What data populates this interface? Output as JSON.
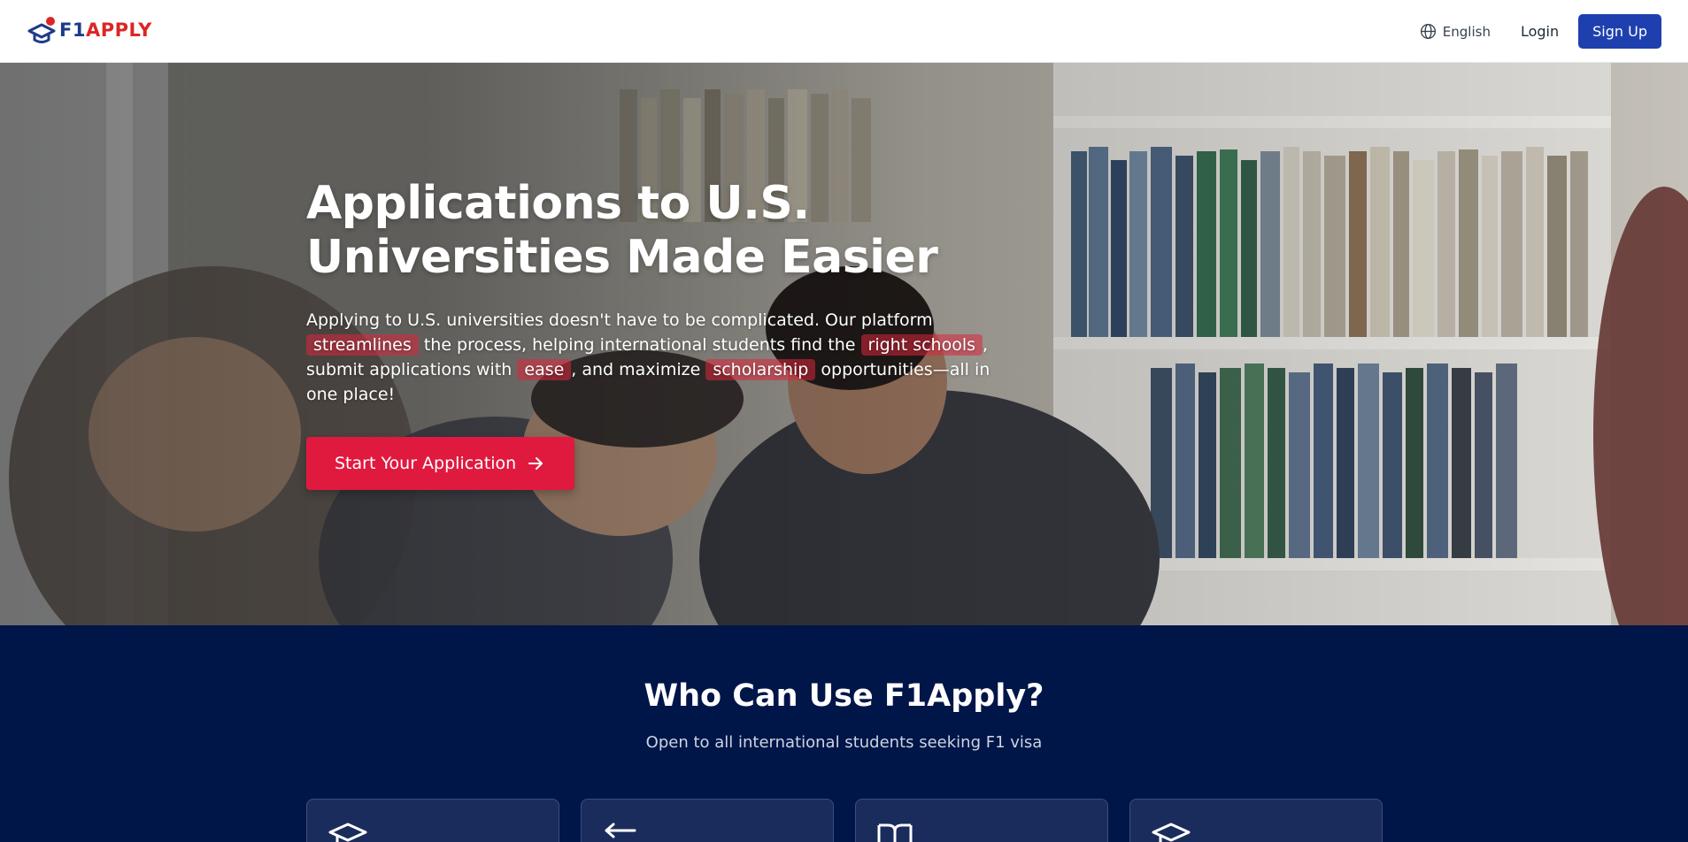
{
  "header": {
    "logo_f1": "F1",
    "logo_apply": "APPLY",
    "language_label": "English",
    "language_icon": "globe-icon",
    "login_label": "Login",
    "signup_label": "Sign Up"
  },
  "hero": {
    "title": "Applications to U.S. Universities Made Easier",
    "description": {
      "part1": "Applying to U.S. universities doesn't have to be complicated. Our platform ",
      "highlight1": "streamlines",
      "part2": " the process, helping international students find the ",
      "highlight2": "right schools",
      "part3": ", submit applications with ",
      "highlight3": "ease",
      "part4": ", and maximize ",
      "highlight4": "scholarship",
      "part5": " opportunities—all in one place!"
    },
    "cta_label": "Start Your Application",
    "cta_icon": "arrow-right-icon"
  },
  "who": {
    "title": "Who Can Use F1Apply?",
    "subtitle": "Open to all international students seeking F1 visa",
    "cards": [
      {
        "icon": "graduation-cap-icon"
      },
      {
        "icon": "arrow-left-icon"
      },
      {
        "icon": "book-open-icon"
      },
      {
        "icon": "graduation-cap-icon"
      }
    ]
  },
  "colors": {
    "brand_blue": "#1e40af",
    "brand_red": "#e0193f",
    "section_navy": "#001548"
  }
}
